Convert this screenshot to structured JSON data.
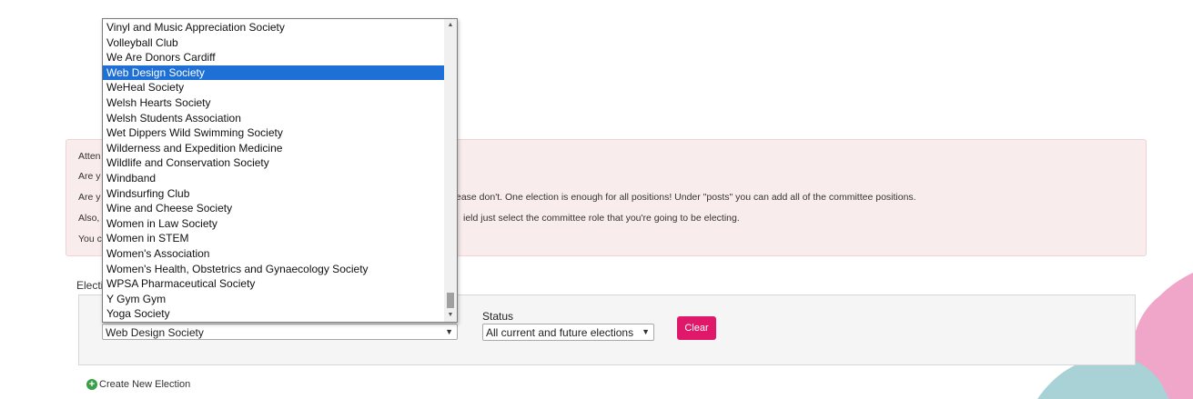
{
  "notice": {
    "line1": "Atten",
    "line2": "Are y",
    "line3_left": "Are y",
    "line3_right": "ease don't. One election is enough for all positions! Under \"posts\" you can add all of the committee positions.",
    "line4_left": "Also,",
    "line4_right": "ield just select the committee role that you're going to be electing.",
    "line5": "You c"
  },
  "elections_label": "Electi",
  "filters": {
    "society_value": "Web Design Society",
    "status_label": "Status",
    "status_value": "All current and future elections",
    "clear_label": "Clear"
  },
  "create_election_label": "Create New Election",
  "dropdown": {
    "selected_index": 3,
    "options": [
      "Vinyl and Music Appreciation Society",
      "Volleyball Club",
      "We Are Donors Cardiff",
      "Web Design Society",
      "WeHeal Society",
      "Welsh Hearts Society",
      "Welsh Students Association",
      "Wet Dippers Wild Swimming Society",
      "Wilderness and Expedition Medicine",
      "Wildlife and Conservation Society",
      "Windband",
      "Windsurfing Club",
      "Wine and Cheese Society",
      "Women in Law Society",
      "Women in STEM",
      "Women's Association",
      "Women's Health, Obstetrics and Gynaecology Society",
      "WPSA Pharmaceutical Society",
      "Y Gym Gym",
      "Yoga Society"
    ]
  },
  "colors": {
    "accent_pink": "#e0186a",
    "selection_blue": "#1e6fd6",
    "alert_bg": "#f9ecec",
    "add_icon_green": "#3aa047"
  },
  "icons": {
    "dropdown_caret": "chevron-down-icon",
    "add": "plus-circle-icon",
    "scroll_up": "scroll-up-arrow-icon",
    "scroll_down": "scroll-down-arrow-icon"
  }
}
